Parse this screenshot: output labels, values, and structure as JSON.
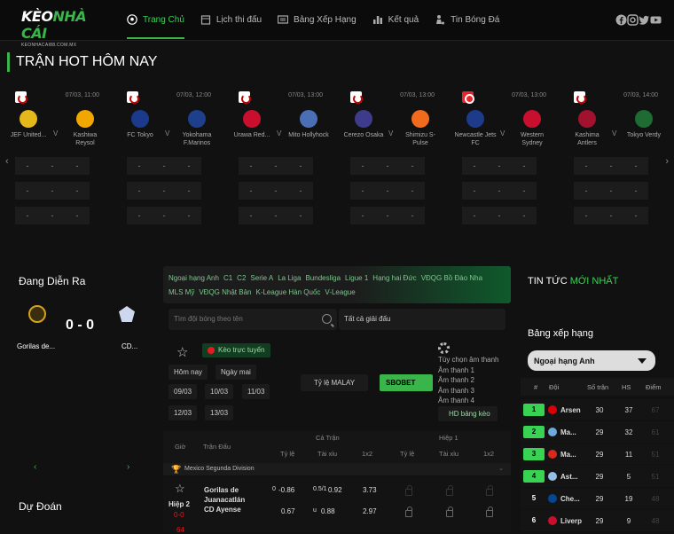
{
  "header": {
    "logo_main_a": "KÈO",
    "logo_main_b": "NHÀ CÁI",
    "logo_sub": "KEONHACAI88.COM.MX",
    "nav": [
      {
        "label": "Trang Chủ",
        "icon": "soccer-ball-icon"
      },
      {
        "label": "Lịch thi đấu",
        "icon": "calendar-icon"
      },
      {
        "label": "Bảng Xếp Hạng",
        "icon": "table-icon"
      },
      {
        "label": "Kết quả",
        "icon": "bar-chart-icon"
      },
      {
        "label": "Tin Bóng Đá",
        "icon": "player-icon"
      }
    ],
    "social": [
      "facebook-icon",
      "instagram-icon",
      "twitter-icon",
      "youtube-icon"
    ]
  },
  "hot": {
    "title": "TRẬN HOT HÔM NAY",
    "vs": "V",
    "odds_placeholder": "-",
    "matches": [
      {
        "time": "07/03, 11:00",
        "home": "JEF United...",
        "away": "Kashiwa Reysol",
        "home_color": "#e4b81a",
        "away_color": "#f2a700",
        "league_color": "white"
      },
      {
        "time": "07/03, 12:00",
        "home": "FC Tokyo",
        "away": "Yokohama F.Marinos",
        "home_color": "#1b3a8c",
        "away_color": "#1e3f8c",
        "league_color": "white"
      },
      {
        "time": "07/03, 13:00",
        "home": "Urawa Red...",
        "away": "Mito Hollyhock",
        "home_color": "#c8102e",
        "away_color": "#4a6fb5",
        "league_color": "white"
      },
      {
        "time": "07/03, 13:00",
        "home": "Cerezo Osaka",
        "away": "Shimizu S-Pulse",
        "home_color": "#3e3a8c",
        "away_color": "#f26b1d",
        "league_color": "white"
      },
      {
        "time": "07/03, 13:00",
        "home": "Newcastle Jets FC",
        "away": "Western Sydney",
        "home_color": "#1e3a8a",
        "away_color": "#c8102e",
        "league_color": "red"
      },
      {
        "time": "07/03, 14:00",
        "home": "Kashima Antlers",
        "away": "Tokyo Verdy",
        "home_color": "#a0122d",
        "away_color": "#1e6b34",
        "league_color": "white"
      }
    ]
  },
  "live": {
    "title": "Đang Diễn Ra",
    "score": "0 - 0",
    "home": "Gorilas de...",
    "away": "CD...",
    "prev": "‹",
    "next": "›"
  },
  "predict_title": "Dự Đoán",
  "filters": {
    "leagues": [
      "Ngoại hạng Anh",
      "C1",
      "C2",
      "Serie A",
      "La Liga",
      "Bundesliga",
      "Ligue 1",
      "Hạng hai Đức",
      "VĐQG Bồ Đào Nha",
      "MLS Mỹ",
      "VĐQG Nhật Bản",
      "K-League Hàn Quốc",
      "V-League"
    ],
    "search_placeholder": "Tìm đội bóng theo tên",
    "all_leagues": "Tất cả giải đấu",
    "live_btn": "Kèo trực tuyến",
    "today": "Hôm nay",
    "tomorrow": "Ngày mai",
    "dates": [
      "09/03",
      "10/03",
      "11/03",
      "12/03",
      "13/03"
    ],
    "odds_type": "Tỷ lệ MALAY",
    "bookmaker": "SBOBET",
    "sound_options": [
      "Tùy chọn âm thanh",
      "Âm thanh 1",
      "Âm thanh 2",
      "Âm thanh 3",
      "Âm thanh 4"
    ],
    "hd_btn": "HD bảng kèo"
  },
  "table": {
    "col_time": "Giờ",
    "col_match": "Trận Đấu",
    "full_time": "Cả Trận",
    "half_time": "Hiệp 1",
    "sub_cols": [
      "Tỷ lệ",
      "Tài xỉu",
      "1x2",
      "Tỷ lệ",
      "Tài xỉu",
      "1x2"
    ],
    "league_row": "Mexico Segunda Division",
    "row": {
      "period": "Hiệp 2",
      "score": "0-0",
      "minute": "64",
      "home": "Gorilas de Juanacatlán",
      "away": "CD Ayense",
      "hdp_label_1": "0",
      "hdp_1": "-0.86",
      "ou_label_1": "0.5/1",
      "ou_1": "0.92",
      "x12_1": "3.73",
      "hdp_2": "0.67",
      "ou_label_2": "u",
      "ou_2": "0.88",
      "x12_2": "2.97"
    }
  },
  "news": {
    "title_a": "TIN TỨC",
    "title_b": "MỚI NHẤT"
  },
  "standings": {
    "title": "Bảng xếp hạng",
    "selected": "Ngoại hạng Anh",
    "head": {
      "rank": "#",
      "team": "Đội",
      "played": "Số trận",
      "gd": "HS",
      "pts": "Điểm"
    },
    "rows": [
      {
        "rank": "1",
        "team": "Arsen",
        "played": "30",
        "gd": "37",
        "pts": "67",
        "crest": "#db0007",
        "zone": "green"
      },
      {
        "rank": "2",
        "team": "Ma...",
        "played": "29",
        "gd": "32",
        "pts": "61",
        "crest": "#6cabdd",
        "zone": "green"
      },
      {
        "rank": "3",
        "team": "Ma...",
        "played": "29",
        "gd": "11",
        "pts": "51",
        "crest": "#da291c",
        "zone": "green"
      },
      {
        "rank": "4",
        "team": "Ast...",
        "played": "29",
        "gd": "5",
        "pts": "51",
        "crest": "#95bfe5",
        "zone": "green"
      },
      {
        "rank": "5",
        "team": "Che...",
        "played": "29",
        "gd": "19",
        "pts": "48",
        "crest": "#034694",
        "zone": "plain"
      },
      {
        "rank": "6",
        "team": "Liverp",
        "played": "29",
        "gd": "9",
        "pts": "48",
        "crest": "#c8102e",
        "zone": "plain"
      }
    ]
  }
}
